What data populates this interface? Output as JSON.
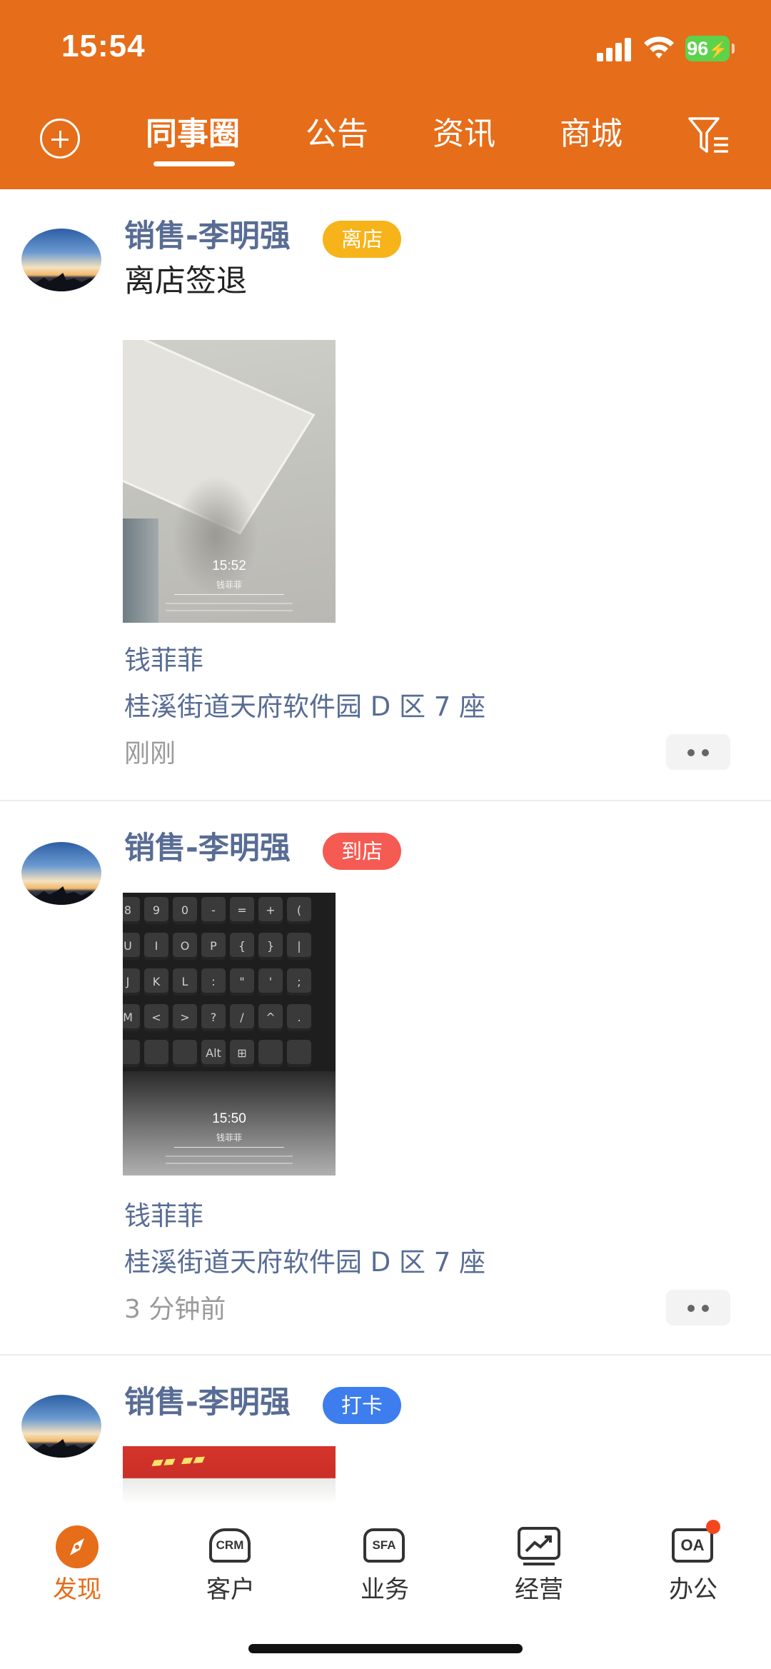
{
  "status_bar": {
    "time": "15:54",
    "battery": "96"
  },
  "header": {
    "tabs": [
      {
        "label": "同事圈",
        "active": true
      },
      {
        "label": "公告",
        "active": false
      },
      {
        "label": "资讯",
        "active": false
      },
      {
        "label": "商城",
        "active": false
      }
    ],
    "accent_color": "#e66d19"
  },
  "posts": [
    {
      "author": "销售-李明强",
      "badge": "离店",
      "badge_color": "#f7b31a",
      "text": "离店签退",
      "photo": {
        "stamp_time": "15:52",
        "stamp_name": "钱菲菲"
      },
      "location_name": "钱菲菲",
      "location_address": "桂溪街道天府软件园 D 区 7 座",
      "time_ago": "刚刚"
    },
    {
      "author": "销售-李明强",
      "badge": "到店",
      "badge_color": "#f55b52",
      "photo": {
        "stamp_time": "15:50",
        "stamp_name": "钱菲菲"
      },
      "location_name": "钱菲菲",
      "location_address": "桂溪街道天府软件园 D 区 7 座",
      "time_ago": "3 分钟前"
    },
    {
      "author": "销售-李明强",
      "badge": "打卡",
      "badge_color": "#3d7dee"
    }
  ],
  "bottom_nav": {
    "items": [
      {
        "label": "发现",
        "icon": "compass-icon",
        "active": true
      },
      {
        "label": "客户",
        "icon": "crm-icon",
        "icon_text": "CRM"
      },
      {
        "label": "业务",
        "icon": "sfa-icon",
        "icon_text": "SFA"
      },
      {
        "label": "经营",
        "icon": "trend-chart-icon"
      },
      {
        "label": "办公",
        "icon": "oa-icon",
        "icon_text": "OA",
        "has_notification": true
      }
    ]
  }
}
